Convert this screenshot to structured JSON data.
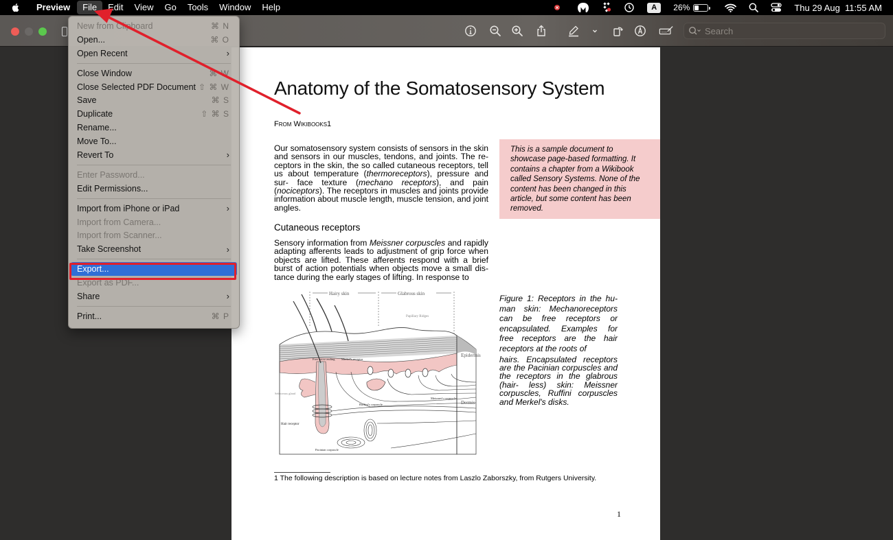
{
  "menubar": {
    "app_name": "Preview",
    "items": [
      "File",
      "Edit",
      "View",
      "Go",
      "Tools",
      "Window",
      "Help"
    ],
    "active_item": "File",
    "status": {
      "battery_percent": "26%",
      "battery_level": 0.26,
      "input_source": "A",
      "datetime": "Thu 29 Aug  11:55 AM"
    }
  },
  "toolbar": {
    "search_placeholder": "Search",
    "tools": [
      "info",
      "zoom-out",
      "zoom-in",
      "share",
      "markup-highlight",
      "markup-dropdown",
      "rotate",
      "markup-pen",
      "signature"
    ]
  },
  "file_menu": {
    "groups": [
      [
        {
          "label": "New from Clipboard",
          "shortcut": "⌘ N",
          "disabled": true
        },
        {
          "label": "Open...",
          "shortcut": "⌘ O"
        },
        {
          "label": "Open Recent",
          "submenu": true
        }
      ],
      [
        {
          "label": "Close Window",
          "shortcut": "⌘ W"
        },
        {
          "label": "Close Selected PDF Document",
          "shortcut": "⇧ ⌘ W"
        },
        {
          "label": "Save",
          "shortcut": "⌘ S"
        },
        {
          "label": "Duplicate",
          "shortcut": "⇧ ⌘ S"
        },
        {
          "label": "Rename..."
        },
        {
          "label": "Move To..."
        },
        {
          "label": "Revert To",
          "submenu": true
        }
      ],
      [
        {
          "label": "Enter Password...",
          "disabled": true
        },
        {
          "label": "Edit Permissions..."
        }
      ],
      [
        {
          "label": "Import from iPhone or iPad",
          "submenu": true
        },
        {
          "label": "Import from Camera...",
          "disabled": true
        },
        {
          "label": "Import from Scanner...",
          "disabled": true
        },
        {
          "label": "Take Screenshot",
          "submenu": true
        }
      ],
      [
        {
          "label": "Export...",
          "highlighted": true
        },
        {
          "label": "Export as PDF...",
          "disabled": true
        },
        {
          "label": "Share",
          "submenu": true
        }
      ],
      [
        {
          "label": "Print...",
          "shortcut": "⌘ P"
        }
      ]
    ],
    "chevron": "›"
  },
  "document": {
    "title": "Anatomy of the Somatosensory System",
    "from": "From Wikibooks1",
    "paragraph1": [
      {
        "t": "Our somatosensory system consists of sensors in the skin and sensors in our muscles, tendons, and joints. The re- ceptors in the skin, the so called cutaneous receptors, tell us about temperature ("
      },
      {
        "t": "thermoreceptors",
        "i": true
      },
      {
        "t": "), pressure and sur- face texture ("
      },
      {
        "t": "mechano receptors",
        "i": true
      },
      {
        "t": "), and pain ("
      },
      {
        "t": "nociceptors",
        "i": true
      },
      {
        "t": "). The receptors in muscles and joints provide information about muscle length, muscle tension, and joint angles."
      }
    ],
    "sidebox": "This is a sample document to showcase page-based formatting. It contains a chapter from a Wikibook called Sensory Systems. None of the content has been changed in this article, but some content has been removed.",
    "section_heading": "Cutaneous receptors",
    "paragraph2": [
      {
        "t": "Sensory information from "
      },
      {
        "t": "Meissner corpuscles",
        "i": true
      },
      {
        "t": " and rapidly adapting afferents leads to adjustment of grip force when objects are lifted. These afferents respond with a brief burst of action potentials when objects move a small dis- tance during the early stages of lifting. In response to"
      }
    ],
    "figure_labels": {
      "hairy_skin": "Hairy skin",
      "glabrous_skin": "Glabrous skin",
      "papillary_ridges": "Papillary Ridges",
      "epidermis": "Epidermis",
      "dermis": "Dermis",
      "free_nerve": "Free nerve ending",
      "merkel": "Merkel's receptor",
      "sebaceous": "Sebaceous gland",
      "meissner": "Meissner's corpuscle",
      "ruffini": "Ruffini's corpuscle",
      "hair_receptor": "Hair receptor",
      "pacinian": "Pacinian corpuscle"
    },
    "caption_part1": "Figure 1: Receptors in the hu- man skin: Mechanoreceptors can be free receptors or encapsulated. Examples for free receptors are the hair receptors at the roots of",
    "caption_part2": "hairs. Encapsulated receptors are the Pacinian corpuscles and the receptors in the glabrous (hair- less) skin: Meissner corpuscles, Ruffini corpuscles and Merkel's disks.",
    "footnote": "1 The following description is based on lecture notes from Laszlo Zaborszky, from Rutgers University.",
    "page_number": "1"
  },
  "annotation": {
    "color": "#e0202b",
    "target": "File menu",
    "highlighted_item": "Export..."
  },
  "colors": {
    "menu_highlight": "#2f6fd6",
    "sidebox_bg": "#f5cccc",
    "skin_pink": "#f2c6c4"
  }
}
